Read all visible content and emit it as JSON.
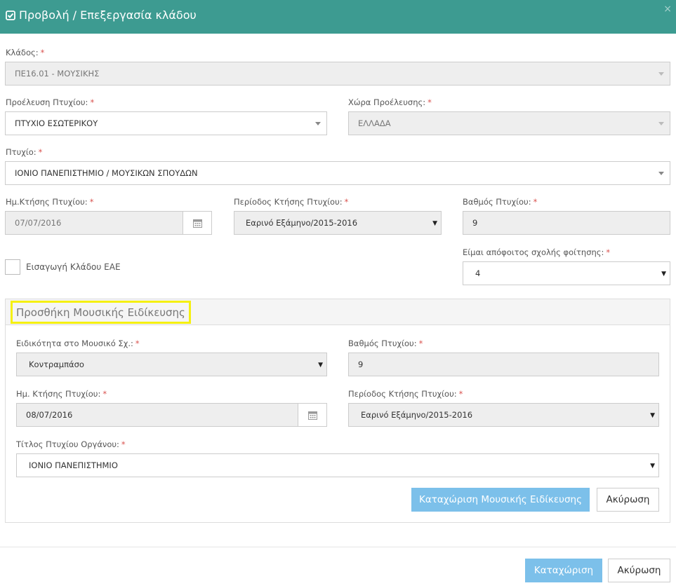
{
  "dialog": {
    "title": "Προβολή / Επεξεργασία κλάδου",
    "close": "×"
  },
  "required_mark": "*",
  "form": {
    "klados": {
      "label": "Κλάδος:",
      "value": "ΠΕ16.01 - ΜΟΥΣΙΚΗΣ"
    },
    "proeleusi": {
      "label": "Προέλευση Πτυχίου:",
      "value": "ΠΤΥΧΙΟ ΕΣΩΤΕΡΙΚΟΥ"
    },
    "xora": {
      "label": "Χώρα Προέλευσης:",
      "value": "ΕΛΛΑΔΑ"
    },
    "ptyxio": {
      "label": "Πτυχίο:",
      "value": "ΙΟΝΙΟ ΠΑΝΕΠΙΣΤΗΜΙΟ / ΜΟΥΣΙΚΩΝ ΣΠΟΥΔΩΝ"
    },
    "date": {
      "label": "Ημ.Κτήσης Πτυχίου:",
      "value": "07/07/2016"
    },
    "period": {
      "label": "Περίοδος Κτήσης Πτυχίου:",
      "value": "Εαρινό Εξάμηνο/2015-2016"
    },
    "grade": {
      "label": "Βαθμός Πτυχίου:",
      "value": "9"
    },
    "eae": {
      "label": "Εισαγωγή Κλάδου ΕΑΕ"
    },
    "apofoitos": {
      "label": "Είμαι απόφοιτος σχολής φοίτησης:",
      "value": "4"
    }
  },
  "music": {
    "title": "Προσθήκη Μουσικής Ειδίκευσης",
    "specialty": {
      "label": "Ειδικότητα στο Μουσικό Σχ.:",
      "value": "Κοντραμπάσο"
    },
    "grade": {
      "label": "Βαθμός Πτυχίου:",
      "value": "9"
    },
    "date": {
      "label": "Ημ. Κτήσης Πτυχίου:",
      "value": "08/07/2016"
    },
    "period": {
      "label": "Περίοδος Κτήσης Πτυχίου:",
      "value": "Εαρινό Εξάμηνο/2015-2016"
    },
    "instrument_title": {
      "label": "Τίτλος Πτυχίου Οργάνου:",
      "value": "ΙΟΝΙΟ ΠΑΝΕΠΙΣΤΗΜΙΟ"
    },
    "save_label": "Καταχώριση Μουσικής Ειδίκευσης",
    "cancel_label": "Ακύρωση"
  },
  "footer": {
    "save_label": "Καταχώριση",
    "cancel_label": "Ακύρωση"
  },
  "colors": {
    "header": "#3d9b91",
    "primary_button": "#7cc0ea",
    "highlight_border": "#f5f010",
    "required": "#d9534f"
  }
}
